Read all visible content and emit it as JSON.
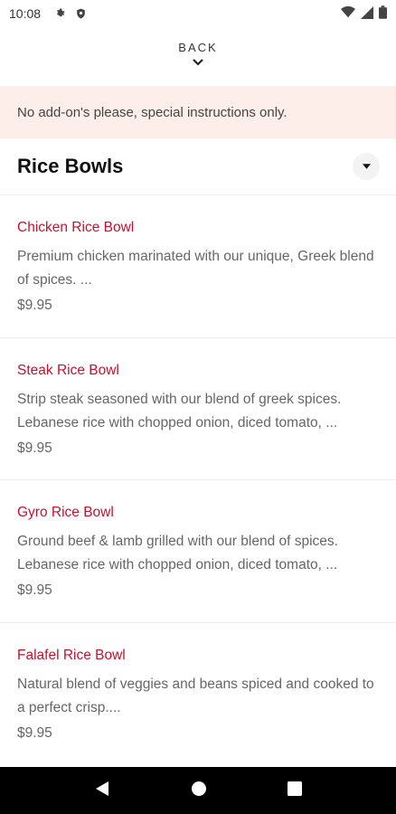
{
  "status_bar": {
    "time": "10:08",
    "icons_left": [
      "gear-icon",
      "shield-icon"
    ],
    "icons_right": [
      "wifi-icon",
      "signal-icon",
      "battery-icon"
    ]
  },
  "back": {
    "label": "BACK"
  },
  "notice": {
    "text": "No add-on's please, special instructions only."
  },
  "section": {
    "title": "Rice Bowls"
  },
  "items": [
    {
      "name": "Chicken Rice Bowl",
      "description": "Premium chicken marinated with our unique, Greek blend of spices. ...",
      "price": "$9.95"
    },
    {
      "name": "Steak Rice Bowl",
      "description": "Strip steak seasoned with our blend of greek spices. Lebanese rice with chopped onion, diced tomato, ...",
      "price": "$9.95"
    },
    {
      "name": "Gyro Rice Bowl",
      "description": "Ground beef & lamb grilled with our blend of spices. Lebanese rice with chopped onion, diced tomato, ...",
      "price": "$9.95"
    },
    {
      "name": "Falafel Rice Bowl",
      "description": "Natural blend of veggies and beans spiced and cooked to a perfect crisp....",
      "price": "$9.95"
    }
  ],
  "nav": {
    "buttons": [
      "back-icon",
      "home-icon",
      "recents-icon"
    ]
  },
  "colors": {
    "accent": "#c8102e",
    "notice_bg": "#fdeeea"
  }
}
